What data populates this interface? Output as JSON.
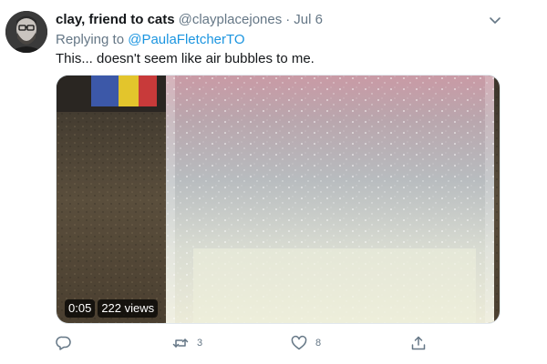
{
  "tweet": {
    "author": {
      "display_name": "clay, friend to cats",
      "handle": "@clayplacejones",
      "avatar_icon": "user-avatar-photo"
    },
    "separator": "·",
    "timestamp": "Jul 6",
    "reply_prefix": "Replying to ",
    "reply_to": "@PaulaFletcherTO",
    "text": "This... doesn't seem like air bubbles to me.",
    "media": {
      "type": "video",
      "duration": "0:05",
      "views": "222 views"
    },
    "actions": {
      "reply_count": "",
      "retweet_count": "3",
      "like_count": "8"
    },
    "icons": {
      "more": "chevron-down-icon",
      "reply": "reply-icon",
      "retweet": "retweet-icon",
      "like": "heart-icon",
      "share": "share-icon"
    },
    "colors": {
      "link": "#1b95e0",
      "secondary_text": "#657786",
      "primary_text": "#14171a"
    }
  }
}
